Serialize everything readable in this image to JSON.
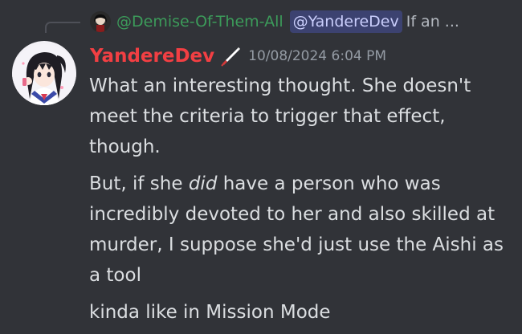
{
  "reply": {
    "author": "@Demise-Of-Them-All",
    "mention": "@YandereDev",
    "preview": "If an ..."
  },
  "message": {
    "author": "YandereDev",
    "timestamp": "10/08/2024 6:04 PM",
    "paragraphs": {
      "p1": "What an interesting thought. She doesn't meet the criteria to trigger that effect, though.",
      "p2_before": "But, if she ",
      "p2_emphasis": "did",
      "p2_after": " have a person who was incredibly devoted to her and also skilled at murder, I suppose she'd just use the Aishi as a tool",
      "p3": "kinda like in Mission Mode"
    }
  },
  "colors": {
    "background": "#313338",
    "author_name": "#f23f43",
    "reply_author": "#3c9b5a",
    "mention_bg": "#3c4270",
    "mention_text": "#c9cdfb",
    "timestamp": "#949ba4",
    "body_text": "#dbdee1"
  },
  "icons": {
    "reply_avatar": "reply-avatar",
    "author_avatar": "anime-avatar",
    "role_icon": "knife-icon"
  }
}
